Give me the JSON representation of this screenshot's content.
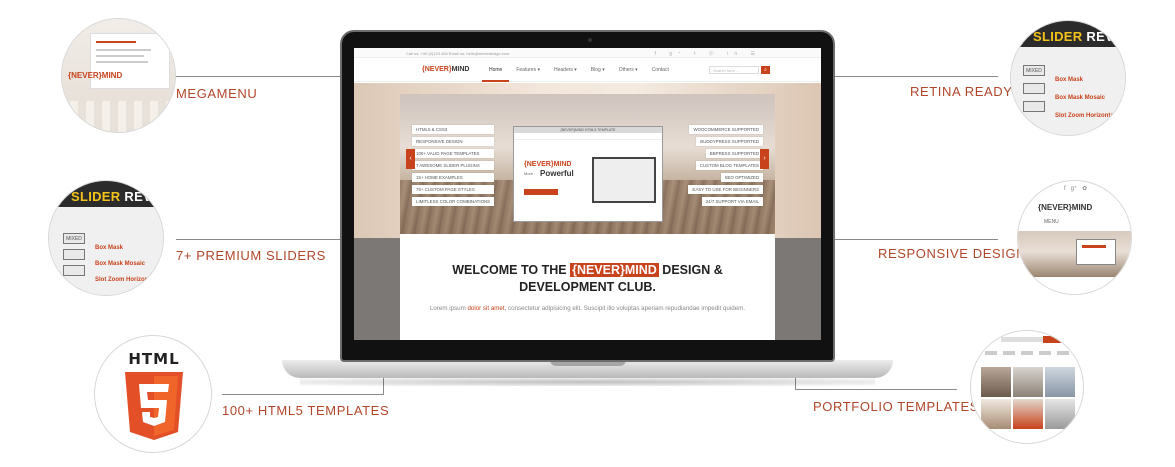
{
  "features": {
    "megamenu": "MEGAMENU",
    "premium_sliders": "7+ PREMIUM SLIDERS",
    "html5_templates": "100+ HTML5 TEMPLATES",
    "retina_ready": "RETINA READY",
    "responsive_design": "RESPONSIVE DESIGN",
    "portfolio_templates": "PORTFOLIO TEMPLATES"
  },
  "colors": {
    "accent": "#c8421b",
    "label": "#b0472a",
    "connector": "#8a8a8a"
  },
  "site": {
    "topbar_text": "Call us: +40 (0)123 456 Email us: hello@neverdesign.com",
    "logo_prefix": "{NEVER}",
    "logo_suffix": "MIND",
    "nav": [
      "Home",
      "Features ▾",
      "Headers ▾",
      "Blog ▾",
      "Others ▾",
      "Contact"
    ],
    "search_placeholder": "Search here ...",
    "slider_left_tags": [
      "HTML5 & CSS3",
      "RESPONSIVE DESIGN",
      "100+ VALID PAGE TEMPLATES",
      "7 AWESOME SLIDER PLUGINS",
      "15+ HOME EXAMPLES",
      "75+ CUSTOM PAGE STYLES",
      "LIMITLESS COLOR COMBINATIONS"
    ],
    "slider_right_tags": [
      "WOOCOMMERCE SUPPORTED",
      "BUDDYPRESS SUPPORTED",
      "BBPRESS SUPPORTED",
      "CUSTOM BLOG TEMPLATES",
      "SEO OPTIMIZED",
      "EASY TO USE FOR BEGINNERS",
      "24/7 SUPPORT VIA EMAIL"
    ],
    "mock_title": "{NEVER}MIND HTML5 TEMPLATE",
    "mock_logo": "{NEVER}MIND",
    "mock_more": "More",
    "mock_powerful": "Powerful",
    "welcome_line1_a": "WELCOME TO THE ",
    "welcome_highlight": "{NEVER}MIND",
    "welcome_line1_b": " DESIGN &",
    "welcome_line2": "DEVELOPMENT CLUB.",
    "lorem_a": "Lorem ipsum ",
    "lorem_highlight": "dolor sit amet",
    "lorem_b": ", consectetur adipisicing elit. Suscipit illo voluptas aperiam repudiandae impedit quidem."
  },
  "bubbles": {
    "megamenu_logo": "{NEVER}MIND",
    "slider_rev_a": "SLIDER",
    "slider_rev_b": " REV",
    "slider_items": [
      "Box Mask",
      "Box Mask Mosaic",
      "Slot Zoom Horizontal"
    ],
    "slider_boxes": [
      "MIXED",
      "",
      ""
    ],
    "responsive_logo": "{NEVER}MIND",
    "responsive_menu": "MENU",
    "html5_word": "HTML",
    "html5_number": "5"
  }
}
